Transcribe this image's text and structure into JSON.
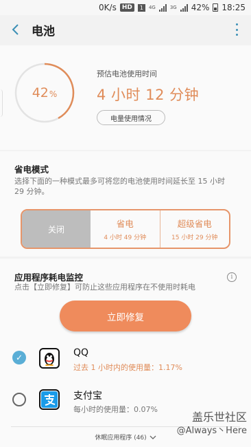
{
  "status_bar": {
    "speed": "0K/s",
    "hd": "HD",
    "sim": "1",
    "net1": "4G",
    "net2": "3G",
    "battery": "42%",
    "time": "18:25"
  },
  "app_bar": {
    "title": "电池"
  },
  "battery": {
    "percent_value": 42,
    "percent_number": "42",
    "percent_unit": "%",
    "estimate_label": "预估电池使用时间",
    "estimate_value": "4 小时 12 分钟",
    "usage_button": "电量使用情况",
    "colors": {
      "accent": "#e08c59",
      "ring_track": "#e3e3e3"
    }
  },
  "power_saving": {
    "title": "省电模式",
    "description_line1": "选择下面的一种模式最多可将您的电池使用时间延长至 15 小时",
    "description_line2": "29 分钟。",
    "modes": [
      {
        "label": "关闭",
        "selected": true
      },
      {
        "label": "省电",
        "sub": "4 小时 49 分钟"
      },
      {
        "label": "超级省电",
        "sub": "15 小时 29 分钟"
      }
    ]
  },
  "app_monitor": {
    "title": "应用程序耗电监控",
    "description": "点击【立即修复】可防止这些应用程序在不使用时耗电",
    "fix_button": "立即修复",
    "apps": [
      {
        "name": "QQ",
        "stat": "过去 1 小时内的使用量：1.17%",
        "checked": true,
        "icon": "qq-penguin-icon"
      },
      {
        "name": "支付宝",
        "stat": "每小时的使用量：0.07%",
        "checked": false,
        "icon": "alipay-icon"
      }
    ],
    "sleeping_apps": "休眠应用程序 (46)"
  },
  "watermark": {
    "line1": "盖乐世社区",
    "line2": "@Always丶Here"
  }
}
